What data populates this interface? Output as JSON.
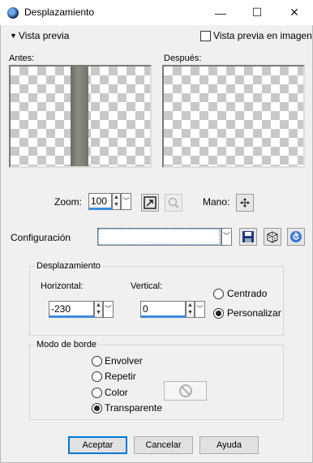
{
  "window": {
    "title": "Desplazamiento",
    "minimize_glyph": "—",
    "maximize_glyph": "☐",
    "close_glyph": "✕"
  },
  "preview": {
    "toggle_label": "Vista previa",
    "toggle_glyph": "▼",
    "in_image_label": "Vista previa en imagen",
    "in_image_checked": false,
    "before_label": "Antes:",
    "after_label": "Después:"
  },
  "zoom": {
    "label": "Zoom:",
    "value": "100",
    "hand_label": "Mano:"
  },
  "config": {
    "label": "Configuración",
    "value": ""
  },
  "offset": {
    "legend": "Desplazamiento",
    "horizontal_label": "Horizontal:",
    "horizontal_value": "-230",
    "vertical_label": "Vertical:",
    "vertical_value": "0",
    "options": [
      {
        "label": "Centrado",
        "selected": false
      },
      {
        "label": "Personalizar",
        "selected": true
      }
    ]
  },
  "border": {
    "legend": "Modo de borde",
    "options": [
      {
        "label": "Envolver",
        "selected": false
      },
      {
        "label": "Repetir",
        "selected": false
      },
      {
        "label": "Color",
        "selected": false
      },
      {
        "label": "Transparente",
        "selected": true
      }
    ]
  },
  "buttons": {
    "ok": "Aceptar",
    "cancel": "Cancelar",
    "help": "Ayuda"
  },
  "colors": {
    "accent": "#0078d7",
    "focus_underline": "#3c8ce0",
    "background": "#f0f0f0"
  },
  "icons": {
    "app": "app-icon",
    "arrow_down": "chevron-down-icon",
    "fit": "fit-window-icon",
    "zoom": "zoom-icon",
    "pan": "pan-move-icon",
    "save": "save-icon",
    "dice": "dice-icon",
    "reset": "reset-icon",
    "no_color": "no-color-icon"
  }
}
